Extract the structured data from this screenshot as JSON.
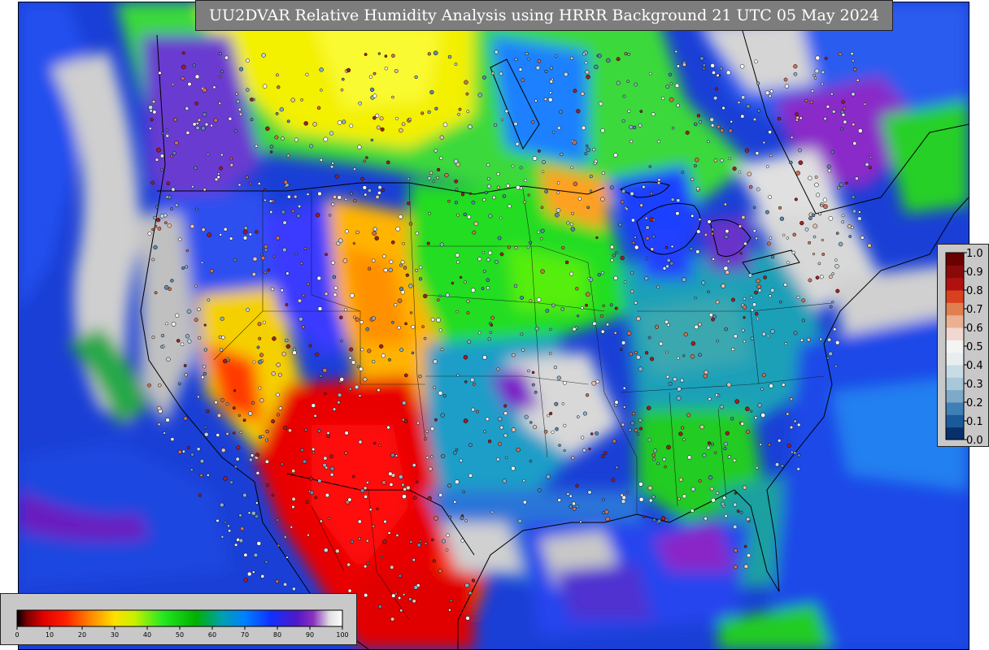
{
  "title": "UU2DVAR Relative Humidity Analysis using HRRR Background 21 UTC 05 May 2024",
  "rh_colorbar": {
    "ticks": [
      "0",
      "10",
      "20",
      "30",
      "40",
      "50",
      "60",
      "70",
      "80",
      "90",
      "100"
    ]
  },
  "error_colorbar": {
    "ticks": [
      "1.0",
      "0.9",
      "0.8",
      "0.7",
      "0.6",
      "0.5",
      "0.4",
      "0.3",
      "0.2",
      "0.1",
      "0.0"
    ]
  },
  "colors": {
    "ocean": "#1a3fd6",
    "very_moist": "#d8d8d8",
    "dry": "#e00000",
    "mid": "#22dd22"
  }
}
